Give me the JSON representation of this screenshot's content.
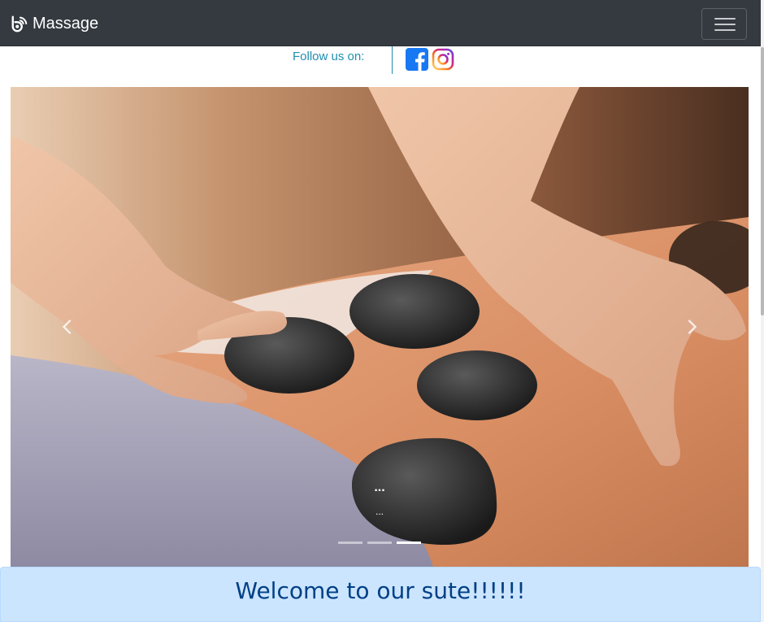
{
  "navbar": {
    "brand": "Massage",
    "brand_icon": "bootstrap-logo-icon",
    "toggler_icon": "hamburger-menu-icon",
    "background": "#343a40"
  },
  "follow": {
    "label": "Follow us on:",
    "links": [
      {
        "name": "facebook-icon",
        "color": "#1877f2"
      },
      {
        "name": "instagram-icon",
        "color": "#e1306c"
      }
    ]
  },
  "carousel": {
    "slide_image": "hot-stone-massage",
    "caption_title": "...",
    "caption_text": "...",
    "prev_icon": "chevron-left-icon",
    "next_icon": "chevron-right-icon",
    "indicators": 3,
    "active_indicator": 3
  },
  "welcome": {
    "text": "Welcome to our sute!!!!!!",
    "color": "#004085",
    "background": "#cce5ff"
  }
}
